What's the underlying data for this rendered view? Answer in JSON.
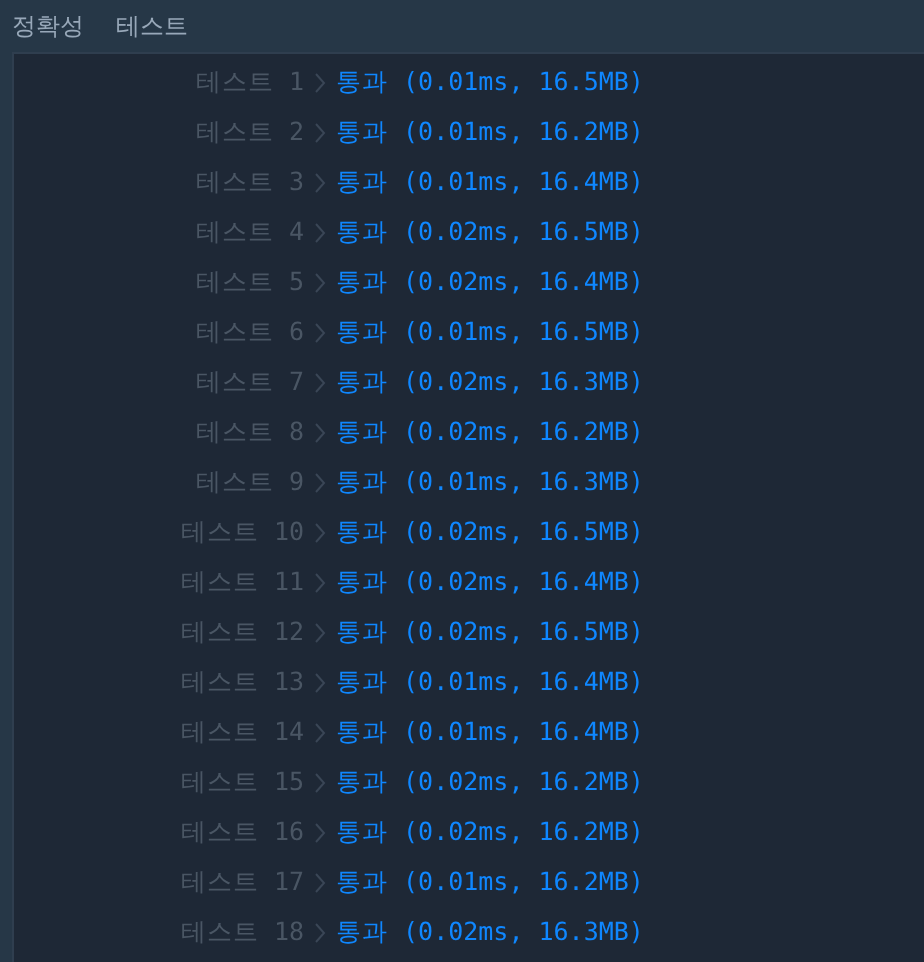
{
  "header": {
    "columns": [
      "정확성",
      "테스트"
    ]
  },
  "results": [
    {
      "label": "테스트 1",
      "result": "통과 (0.01ms, 16.5MB)"
    },
    {
      "label": "테스트 2",
      "result": "통과 (0.01ms, 16.2MB)"
    },
    {
      "label": "테스트 3",
      "result": "통과 (0.01ms, 16.4MB)"
    },
    {
      "label": "테스트 4",
      "result": "통과 (0.02ms, 16.5MB)"
    },
    {
      "label": "테스트 5",
      "result": "통과 (0.02ms, 16.4MB)"
    },
    {
      "label": "테스트 6",
      "result": "통과 (0.01ms, 16.5MB)"
    },
    {
      "label": "테스트 7",
      "result": "통과 (0.02ms, 16.3MB)"
    },
    {
      "label": "테스트 8",
      "result": "통과 (0.02ms, 16.2MB)"
    },
    {
      "label": "테스트 9",
      "result": "통과 (0.01ms, 16.3MB)"
    },
    {
      "label": "테스트 10",
      "result": "통과 (0.02ms, 16.5MB)"
    },
    {
      "label": "테스트 11",
      "result": "통과 (0.02ms, 16.4MB)"
    },
    {
      "label": "테스트 12",
      "result": "통과 (0.02ms, 16.5MB)"
    },
    {
      "label": "테스트 13",
      "result": "통과 (0.01ms, 16.4MB)"
    },
    {
      "label": "테스트 14",
      "result": "통과 (0.01ms, 16.4MB)"
    },
    {
      "label": "테스트 15",
      "result": "통과 (0.02ms, 16.2MB)"
    },
    {
      "label": "테스트 16",
      "result": "통과 (0.02ms, 16.2MB)"
    },
    {
      "label": "테스트 17",
      "result": "통과 (0.01ms, 16.2MB)"
    },
    {
      "label": "테스트 18",
      "result": "통과 (0.02ms, 16.3MB)"
    }
  ]
}
